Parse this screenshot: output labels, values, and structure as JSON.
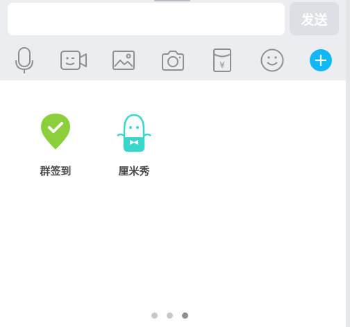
{
  "composer": {
    "input_value": "",
    "send_label": "发送"
  },
  "toolbar": {
    "items": [
      {
        "icon": "microphone-icon"
      },
      {
        "icon": "video-call-icon"
      },
      {
        "icon": "image-icon"
      },
      {
        "icon": "camera-icon"
      },
      {
        "icon": "red-packet-icon"
      },
      {
        "icon": "emoji-icon"
      },
      {
        "icon": "plus-icon"
      }
    ],
    "red_packet_symbol": "¥"
  },
  "apps": [
    {
      "label": "群签到",
      "icon": "group-checkin-icon",
      "color": "#8bcf3c"
    },
    {
      "label": "厘米秀",
      "icon": "cmshow-icon",
      "color": "#39d6cc"
    }
  ],
  "pager": {
    "pages": 3,
    "active_page": 3
  },
  "colors": {
    "toolbar_bg": "#ebedf1",
    "icon_gray": "#8d8f93",
    "accent_blue": "#12b7f5",
    "send_disabled_bg": "#dcdfe4"
  }
}
